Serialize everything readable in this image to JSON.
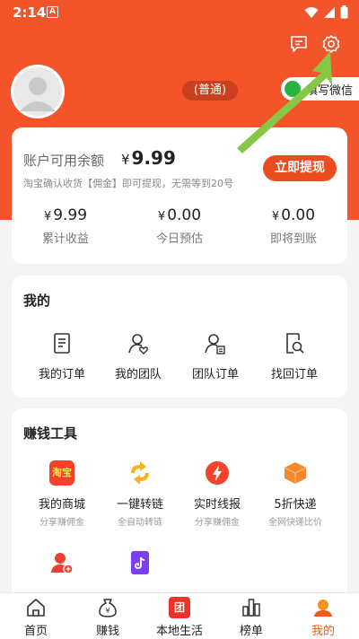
{
  "status": {
    "time": "2:14",
    "notif_letter": "A"
  },
  "profile": {
    "level": "(普通)",
    "wechat_label": "填写微信"
  },
  "balance": {
    "label": "账户可用余额",
    "currency": "¥",
    "amount": "9.99",
    "hint": "淘宝确认收货【佣金】即可提现，无需等到20号",
    "withdraw_label": "立即提现",
    "stats": [
      {
        "value": "9.99",
        "label": "累计收益"
      },
      {
        "value": "0.00",
        "label": "今日预估"
      },
      {
        "value": "0.00",
        "label": "即将到账"
      }
    ]
  },
  "orders": {
    "title": "我的",
    "items": [
      {
        "label": "我的订单",
        "icon": "document-icon"
      },
      {
        "label": "我的团队",
        "icon": "team-icon"
      },
      {
        "label": "团队订单",
        "icon": "team-order-icon"
      },
      {
        "label": "找回订单",
        "icon": "search-order-icon"
      }
    ]
  },
  "tools": {
    "title": "赚钱工具",
    "items": [
      {
        "label": "我的商城",
        "sub": "分享赚佣金",
        "icon_text": "淘宝",
        "color": "#f4402c"
      },
      {
        "label": "一键转链",
        "sub": "全自动转链",
        "color": "#f8b21f"
      },
      {
        "label": "实时线报",
        "sub": "分享赚佣金",
        "color": "#f2442a"
      },
      {
        "label": "5折快递",
        "sub": "全网快递比价",
        "color": "#f5862a"
      },
      {
        "label": "",
        "sub": "",
        "color": "#e9402f"
      },
      {
        "label": "",
        "sub": "",
        "color": "#7b3ff2"
      }
    ]
  },
  "tabbar": {
    "items": [
      {
        "label": "首页",
        "icon": "home-icon"
      },
      {
        "label": "赚钱",
        "icon": "money-bag-icon"
      },
      {
        "label": "本地生活",
        "icon": "local-life-icon",
        "badge": "团"
      },
      {
        "label": "榜单",
        "icon": "ranking-icon"
      },
      {
        "label": "我的",
        "icon": "profile-icon",
        "active": true
      }
    ]
  },
  "colors": {
    "brand": "#f4542a",
    "button": "#ec4d20",
    "active_tab": "#f25a1c",
    "arrow": "#86c846"
  }
}
